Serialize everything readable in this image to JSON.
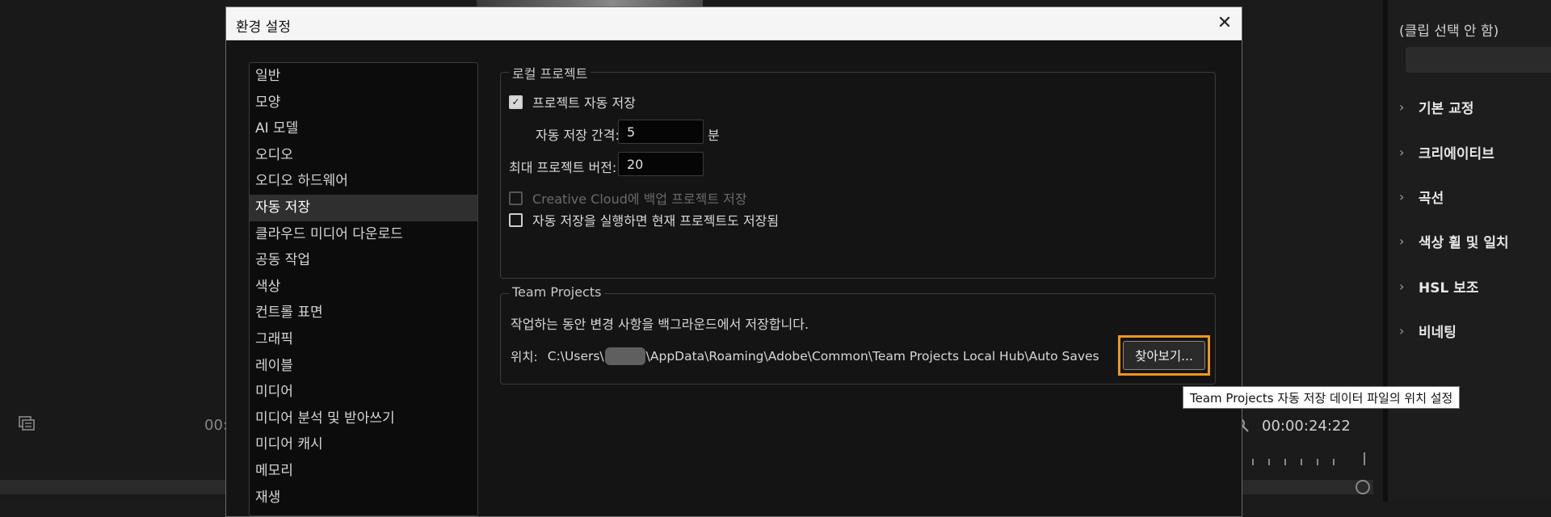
{
  "background": {
    "timecode_left_partial": "00:",
    "timecode_right": "00:00:24:22"
  },
  "lumetri": {
    "clip_label": "(클립 선택 안 함)",
    "sections": [
      "기본 교정",
      "크리에이티브",
      "곡선",
      "색상 휠 및 일치",
      "HSL 보조",
      "비네팅"
    ]
  },
  "dialog": {
    "title": "환경 설정",
    "close_glyph": "✕",
    "categories": [
      "일반",
      "모양",
      "AI 모델",
      "오디오",
      "오디오 하드웨어",
      "자동 저장",
      "클라우드 미디어 다운로드",
      "공동 작업",
      "색상",
      "컨트롤 표면",
      "그래픽",
      "레이블",
      "미디어",
      "미디어 분석 및 받아쓰기",
      "미디어 캐시",
      "메모리",
      "재생"
    ],
    "selected_category": "자동 저장",
    "local_projects": {
      "legend": "로컬 프로젝트",
      "auto_save_label": "프로젝트 자동 저장",
      "auto_save_checked": true,
      "interval_label": "자동 저장 간격:",
      "interval_value": "5",
      "interval_unit": "분",
      "max_versions_label": "최대 프로젝트 버전:",
      "max_versions_value": "20",
      "cloud_backup_label": "Creative Cloud에 백업 프로젝트 저장",
      "cloud_backup_checked": false,
      "save_current_label": "자동 저장을 실행하면 현재 프로젝트도 저장됨",
      "save_current_checked": false
    },
    "team_projects": {
      "legend": "Team Projects",
      "description": "작업하는 동안 변경 사항을 백그라운드에서 저장합니다.",
      "location_label": "위치:",
      "path_prefix": "C:\\Users\\",
      "path_suffix": "\\AppData\\Roaming\\Adobe\\Common\\Team Projects Local Hub\\Auto Saves",
      "browse_label": "찾아보기...",
      "tooltip": "Team Projects 자동 저장 데이터 파일의 위치 설정"
    }
  },
  "colors": {
    "highlight_border": "#f0961e",
    "dialog_bg": "#141414",
    "titlebar_bg": "#f5f5f5"
  }
}
